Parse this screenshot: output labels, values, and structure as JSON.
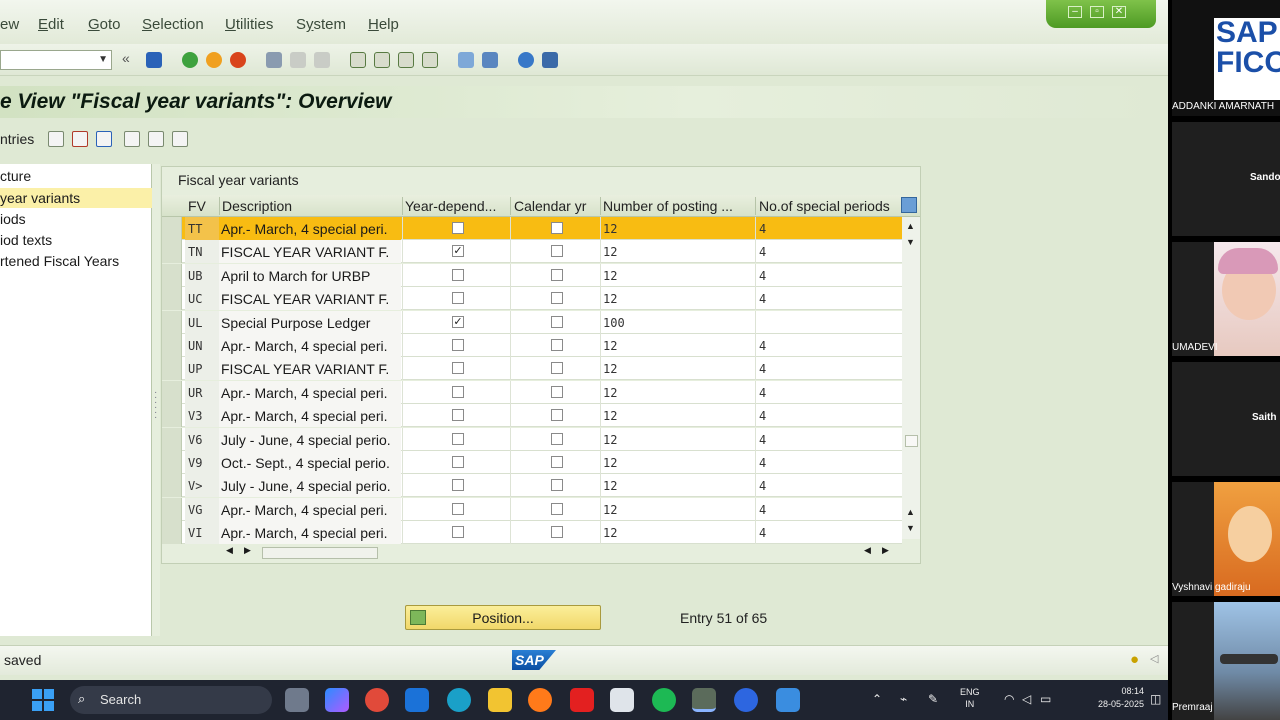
{
  "menu": {
    "items": [
      {
        "pre": "",
        "ul": "",
        "post": "ew"
      },
      {
        "pre": "",
        "ul": "E",
        "post": "dit"
      },
      {
        "pre": "",
        "ul": "G",
        "post": "oto"
      },
      {
        "pre": "",
        "ul": "S",
        "post": "election"
      },
      {
        "pre": "",
        "ul": "U",
        "post": "tilities"
      },
      {
        "pre": "S",
        "ul": "y",
        "post": "stem"
      },
      {
        "pre": "",
        "ul": "H",
        "post": "elp"
      }
    ]
  },
  "title": "e View \"Fiscal year variants\": Overview",
  "app_toolbar": {
    "entries_label": "ntries"
  },
  "nav": {
    "items": [
      {
        "label": "cture"
      },
      {
        "label": "year variants",
        "selected": true
      },
      {
        "label": "iods"
      },
      {
        "label": "iod texts"
      },
      {
        "label": "rtened Fiscal Years"
      }
    ]
  },
  "table": {
    "title": "Fiscal year variants",
    "headers": [
      "FV",
      "Description",
      "Year-depend...",
      "Calendar yr",
      "Number of posting ...",
      "No.of special periods"
    ],
    "rows": [
      {
        "fv": "TT",
        "desc": "Apr.- March, 4 special peri.",
        "yd": false,
        "cal": false,
        "posting": "12",
        "special": "4",
        "highlight": true
      },
      {
        "fv": "TN",
        "desc": "FISCAL YEAR VARIANT F.",
        "yd": true,
        "cal": false,
        "posting": "12",
        "special": "4"
      },
      {
        "fv": "UB",
        "desc": "April to March for URBP",
        "yd": false,
        "cal": false,
        "posting": "12",
        "special": "4"
      },
      {
        "fv": "UC",
        "desc": "FISCAL YEAR VARIANT F.",
        "yd": false,
        "cal": false,
        "posting": "12",
        "special": "4"
      },
      {
        "fv": "UL",
        "desc": "Special Purpose Ledger",
        "yd": true,
        "cal": false,
        "posting": "100",
        "special": ""
      },
      {
        "fv": "UN",
        "desc": "Apr.- March, 4 special peri.",
        "yd": false,
        "cal": false,
        "posting": "12",
        "special": "4"
      },
      {
        "fv": "UP",
        "desc": "FISCAL YEAR VARIANT F.",
        "yd": false,
        "cal": false,
        "posting": "12",
        "special": "4"
      },
      {
        "fv": "UR",
        "desc": "Apr.- March, 4 special peri.",
        "yd": false,
        "cal": false,
        "posting": "12",
        "special": "4"
      },
      {
        "fv": "V3",
        "desc": "Apr.- March, 4 special peri.",
        "yd": false,
        "cal": false,
        "posting": "12",
        "special": "4"
      },
      {
        "fv": "V6",
        "desc": "July - June, 4 special perio.",
        "yd": false,
        "cal": false,
        "posting": "12",
        "special": "4"
      },
      {
        "fv": "V9",
        "desc": "Oct.- Sept., 4 special perio.",
        "yd": false,
        "cal": false,
        "posting": "12",
        "special": "4"
      },
      {
        "fv": "V>",
        "desc": "July - June, 4 special perio.",
        "yd": false,
        "cal": false,
        "posting": "12",
        "special": "4"
      },
      {
        "fv": "VG",
        "desc": "Apr.- March, 4 special peri.",
        "yd": false,
        "cal": false,
        "posting": "12",
        "special": "4"
      },
      {
        "fv": "VI",
        "desc": "Apr.- March, 4 special peri.",
        "yd": false,
        "cal": false,
        "posting": "12",
        "special": "4"
      }
    ]
  },
  "position_button": "Position...",
  "entry_info": "Entry 51 of 65",
  "status": {
    "text": "saved",
    "logo": "SAP"
  },
  "taskbar": {
    "search_placeholder": "Search",
    "lang_line1": "ENG",
    "lang_line2": "IN",
    "time": "08:14",
    "date": "28-05-2025"
  },
  "participants": [
    {
      "name": "ADDANKI AMARNATH",
      "logo": "SAP FICO"
    },
    {
      "name": "Sando"
    },
    {
      "name": "UMADEVI"
    },
    {
      "name": "Saith"
    },
    {
      "name": "Vyshnavi gadiraju"
    },
    {
      "name": "Premraaj"
    }
  ],
  "colors": {
    "highlight_row": "#f8bc12",
    "nav_selected": "#fbf0a8",
    "sap_green": "#dfe9d4"
  }
}
